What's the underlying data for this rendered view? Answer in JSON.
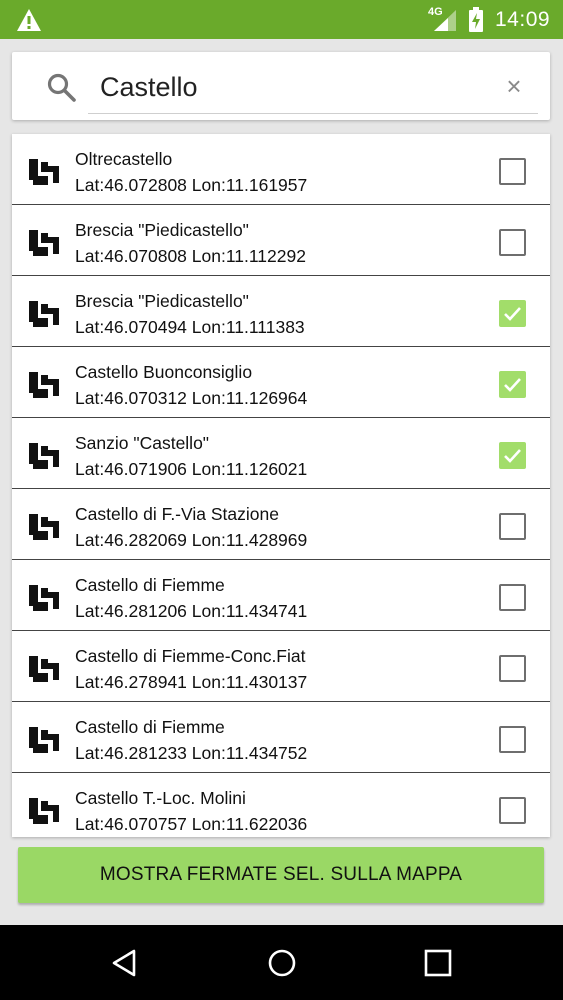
{
  "status_bar": {
    "network_label": "4G",
    "time": "14:09",
    "icons": [
      "warning-icon",
      "signal-icon",
      "battery-charging-icon"
    ]
  },
  "search": {
    "value": "Castello",
    "placeholder": "",
    "icon": "search-icon",
    "clear_label": "×"
  },
  "stops": [
    {
      "name": "Oltrecastello",
      "coords": "Lat:46.072808 Lon:11.161957",
      "checked": false
    },
    {
      "name": "Brescia \"Piedicastello\"",
      "coords": "Lat:46.070808 Lon:11.112292",
      "checked": false
    },
    {
      "name": "Brescia \"Piedicastello\"",
      "coords": "Lat:46.070494 Lon:11.111383",
      "checked": true
    },
    {
      "name": "Castello Buonconsiglio",
      "coords": "Lat:46.070312 Lon:11.126964",
      "checked": true
    },
    {
      "name": "Sanzio \"Castello\"",
      "coords": "Lat:46.071906 Lon:11.126021",
      "checked": true
    },
    {
      "name": "Castello di F.-Via Stazione",
      "coords": "Lat:46.282069 Lon:11.428969",
      "checked": false
    },
    {
      "name": "Castello di Fiemme",
      "coords": "Lat:46.281206 Lon:11.434741",
      "checked": false
    },
    {
      "name": "Castello di Fiemme-Conc.Fiat",
      "coords": "Lat:46.278941 Lon:11.430137",
      "checked": false
    },
    {
      "name": "Castello di Fiemme",
      "coords": "Lat:46.281233 Lon:11.434752",
      "checked": false
    },
    {
      "name": "Castello T.-Loc. Molini",
      "coords": "Lat:46.070757 Lon:11.622036",
      "checked": false
    }
  ],
  "action": {
    "label": "MOSTRA FERMATE SEL. SULLA MAPPA"
  },
  "colors": {
    "status_bar": "#6aaa2b",
    "checkbox_checked": "#a2dd6a",
    "action_button": "#9ad865"
  },
  "nav_bar": {
    "icons": [
      "back-icon",
      "home-icon",
      "recents-icon"
    ]
  }
}
